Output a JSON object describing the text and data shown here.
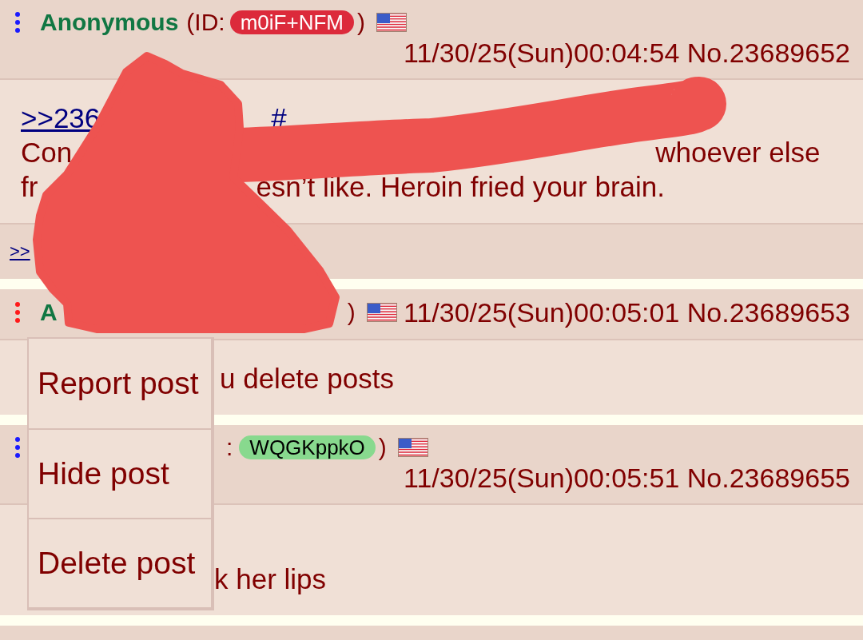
{
  "posts": [
    {
      "menu_open": false,
      "header": [
        {
          "kind": "name",
          "text": "Anonymous"
        },
        {
          "kind": "text",
          "text": "(ID:"
        },
        {
          "kind": "id",
          "text": "m0iF+NFM",
          "color": "#dc2a3b"
        },
        {
          "kind": "text",
          "text": ")"
        }
      ],
      "date": "11/30/25(Sun)00:04:54 No.23689652",
      "body": [
        [
          {
            "kind": "link",
            "text": ">>236"
          },
          {
            "kind": "link",
            "text": "#"
          }
        ],
        [
          {
            "kind": "text",
            "text": "Con"
          },
          {
            "kind": "text",
            "text": "whoever else"
          }
        ],
        [
          {
            "kind": "text",
            "text": "fr"
          },
          {
            "kind": "text",
            "text": "esn’t like. Heroin fried your brain."
          }
        ]
      ],
      "replies": [
        ">>"
      ]
    },
    {
      "menu_open": true,
      "header": [
        {
          "kind": "name",
          "text": "A"
        },
        {
          "kind": "text",
          "text": ")"
        }
      ],
      "date": "11/30/25(Sun)00:05:01 No.23689653",
      "body": [
        [
          {
            "kind": "text",
            "text": "u delete posts"
          }
        ]
      ]
    },
    {
      "menu_open": false,
      "header": [
        {
          "kind": "text",
          "text": ":"
        },
        {
          "kind": "id",
          "text": "WQGKppkO",
          "color": "#88d98e"
        },
        {
          "kind": "text",
          "text": ")"
        }
      ],
      "date": "11/30/25(Sun)00:05:51 No.23689655",
      "body": [
        [
          {
            "kind": "text",
            "text": "k her lips"
          }
        ]
      ]
    }
  ],
  "menu": {
    "items": [
      "Report post",
      "Hide post",
      "Delete post"
    ]
  }
}
